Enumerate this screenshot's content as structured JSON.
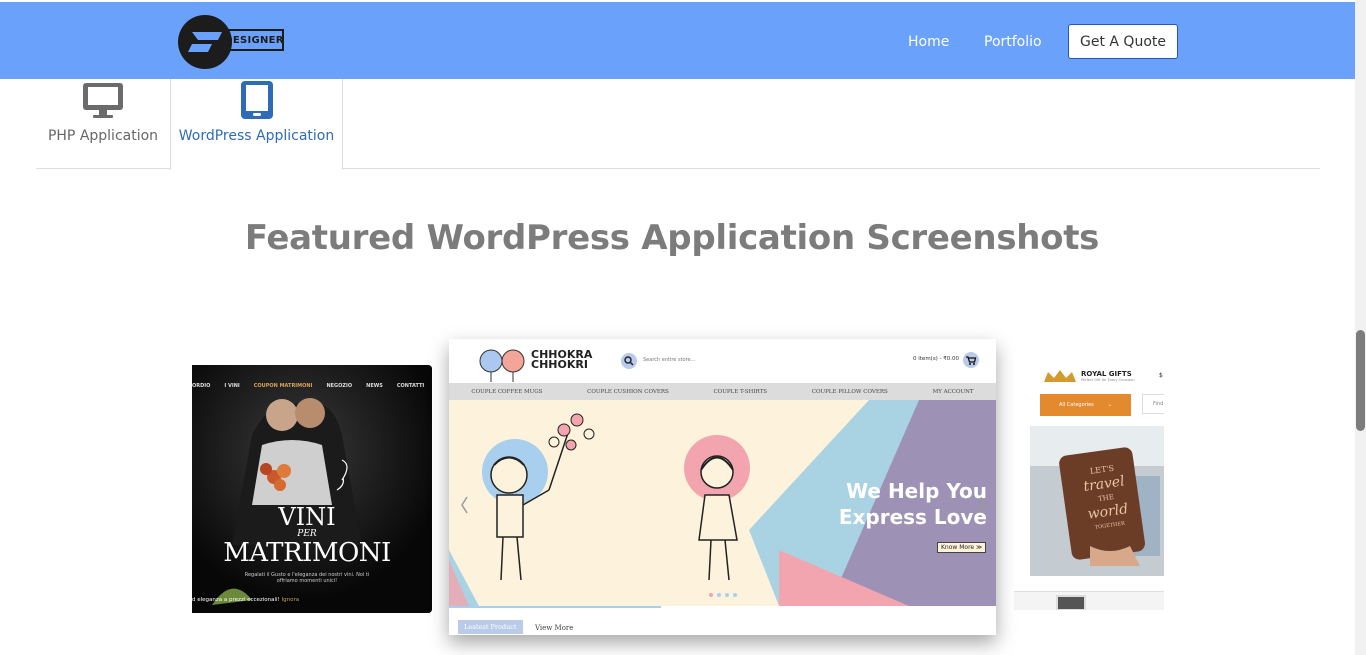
{
  "header": {
    "logo_text": "DESIGNER",
    "nav": [
      "Home",
      "Portfolio"
    ],
    "quote_button": "Get A Quote"
  },
  "tabs": [
    {
      "label": "PHP Application",
      "icon": "desktop-monitor-icon",
      "active": false
    },
    {
      "label": "WordPress Application",
      "icon": "tablet-icon",
      "active": true
    }
  ],
  "section_title": "Featured WordPress Application Screenshots",
  "slides": {
    "left": {
      "menu": [
        "ORDIO",
        "I VINI",
        "COUPON MATRIMONI",
        "NEGOZIO",
        "NEWS",
        "CONTATTI"
      ],
      "headline_1": "VINI",
      "headline_2": "PER",
      "headline_3": "MATRIMONI",
      "subtext_1": "Regalati il Gusto e l'eleganza dei nostri vini. Noi ti",
      "subtext_2": "offriamo momenti unici!",
      "cookie_text": "d eleganza a prezzi eccezionali!",
      "cookie_link": "Ignora"
    },
    "center": {
      "brand_1": "CHHOKRA",
      "brand_2": "CHHOKRI",
      "search_placeholder": "Search entire store...",
      "cart": "0 item(s) - ₹0.00",
      "menu": [
        "COUPLE COFFEE MUGS",
        "COUPLE CUSHION COVERS",
        "COUPLE T-SHIRTS",
        "COUPLE PILLOW COVERS",
        "MY ACCOUNT"
      ],
      "banner_line_1": "We Help You",
      "banner_line_2": "Express Love",
      "banner_button": "Know More ≫",
      "bottom_tab": "Leatest Product",
      "bottom_link": "View More"
    },
    "right": {
      "brand": "ROYAL GIFTS",
      "brand_sub": "Perfect Gift for Every Occasion",
      "category_button": "All Categories",
      "search_text": "Find",
      "product_text_1": "LET'S",
      "product_text_2": "travel",
      "product_text_3": "THE",
      "product_text_4": "world",
      "product_text_5": "TOGETHER"
    }
  },
  "colors": {
    "header_bg": "#6aa1fb",
    "tab_active": "#2f6cb7",
    "title": "#7c7c7c"
  }
}
